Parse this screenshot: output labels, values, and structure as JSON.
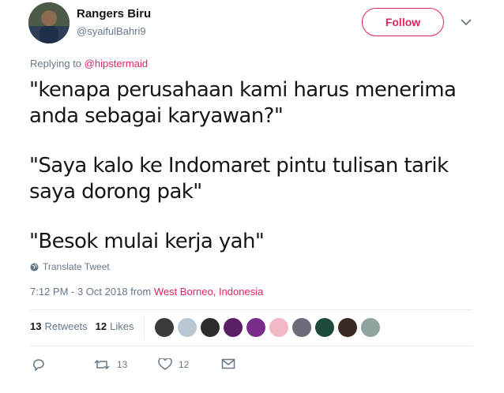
{
  "author": {
    "name": "Rangers Biru",
    "handle": "@syaifulBahri9"
  },
  "follow_label": "Follow",
  "replying": {
    "prefix": "Replying to",
    "to": "@hipstermaid"
  },
  "tweet": {
    "paragraphs": [
      "\"kenapa perusahaan kami harus menerima anda sebagai karyawan?\"",
      "\"Saya kalo ke Indomaret pintu tulisan tarik saya dorong pak\"",
      "\"Besok mulai kerja yah\""
    ]
  },
  "translate_label": "Translate Tweet",
  "timestamp": {
    "time": "7:12 PM - 3 Oct 2018 from",
    "location": "West Borneo, Indonesia"
  },
  "stats": {
    "retweets_count": "13",
    "retweets_label": "Retweets",
    "likes_count": "12",
    "likes_label": "Likes"
  },
  "likers": [
    {
      "color": "#3b3b3b"
    },
    {
      "color": "#b9c7d3"
    },
    {
      "color": "#2c2c2c"
    },
    {
      "color": "#5a1f66"
    },
    {
      "color": "#7b2c8a"
    },
    {
      "color": "#f2b8c6"
    },
    {
      "color": "#6b6b7a"
    },
    {
      "color": "#1d4a3a"
    },
    {
      "color": "#3a2a25"
    },
    {
      "color": "#8fa3a0"
    }
  ],
  "actions": {
    "retweet_count": "13",
    "like_count": "12"
  },
  "colors": {
    "accent": "#e0245e",
    "muted": "#657786",
    "text": "#14171a",
    "divider": "#e6ecf0"
  }
}
